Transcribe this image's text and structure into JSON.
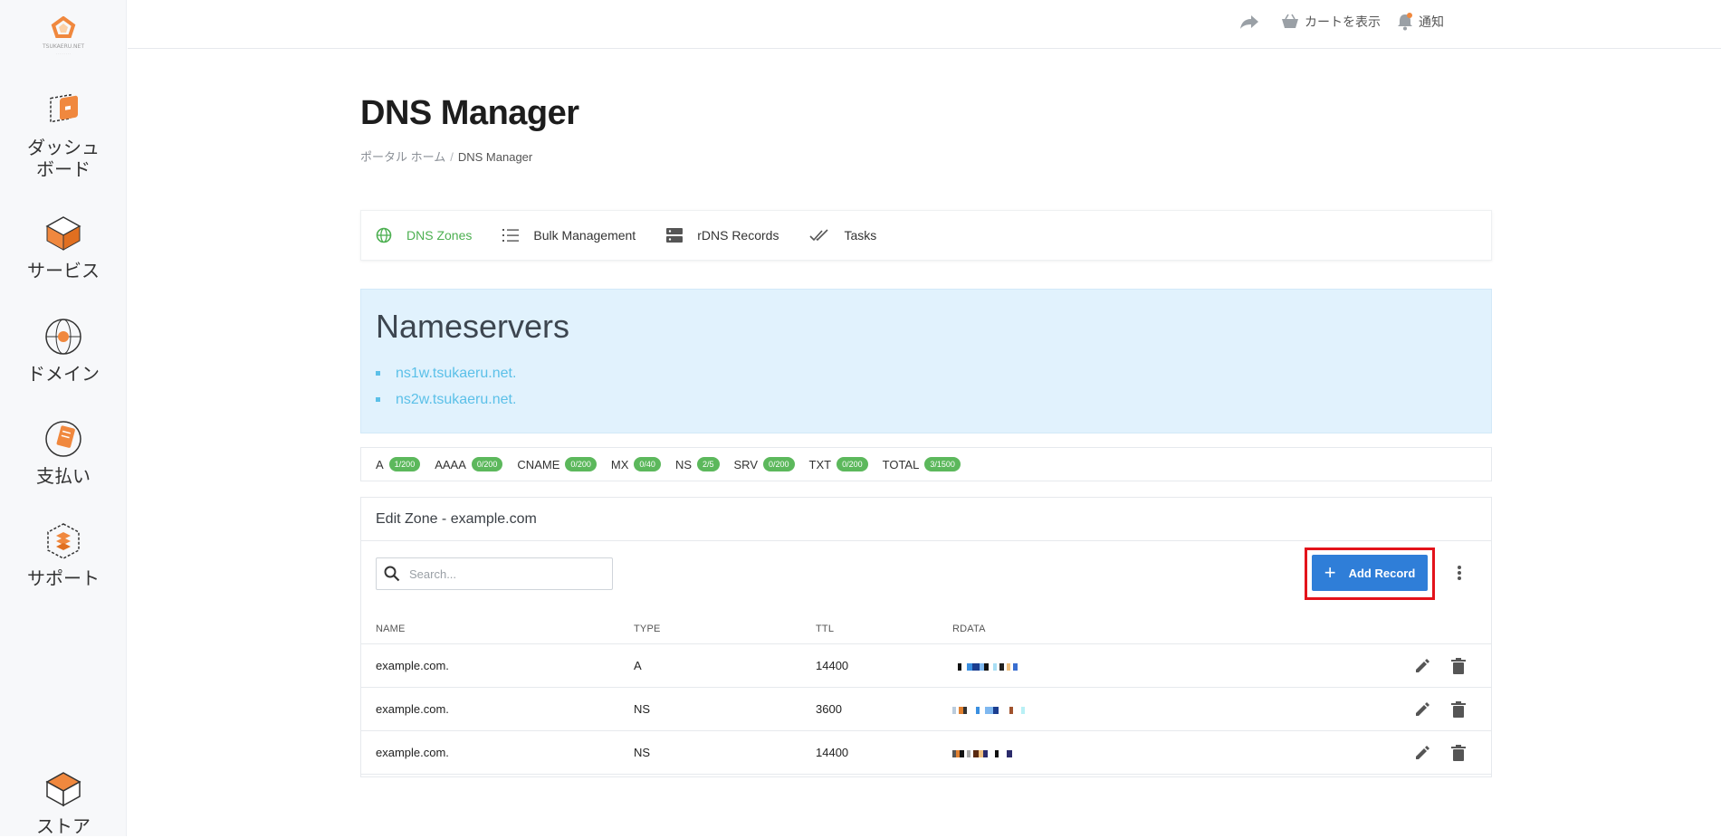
{
  "sidebar": {
    "logo_text": "TSUKAERU.NET",
    "items": [
      {
        "label_line1": "ダッシュ",
        "label_line2": "ボード",
        "icon": "dashboard-icon"
      },
      {
        "label_line1": "サービス",
        "label_line2": "",
        "icon": "services-box-icon"
      },
      {
        "label_line1": "ドメイン",
        "label_line2": "",
        "icon": "globe-icon"
      },
      {
        "label_line1": "支払い",
        "label_line2": "",
        "icon": "billing-icon"
      },
      {
        "label_line1": "サポート",
        "label_line2": "",
        "icon": "support-icon"
      },
      {
        "label_line1": "ストア",
        "label_line2": "",
        "icon": "store-icon"
      }
    ]
  },
  "topbar": {
    "cart_label": "カートを表示",
    "notify_label": "通知"
  },
  "page": {
    "title": "DNS Manager",
    "breadcrumb": [
      "ポータル ホーム",
      "DNS Manager"
    ]
  },
  "tabs": [
    {
      "label": "DNS Zones",
      "active": true
    },
    {
      "label": "Bulk Management",
      "active": false
    },
    {
      "label": "rDNS Records",
      "active": false
    },
    {
      "label": "Tasks",
      "active": false
    }
  ],
  "nameservers": {
    "title": "Nameservers",
    "items": [
      "ns1w.tsukaeru.net.",
      "ns2w.tsukaeru.net."
    ]
  },
  "record_counts": [
    {
      "type": "A",
      "count": "1/200"
    },
    {
      "type": "AAAA",
      "count": "0/200"
    },
    {
      "type": "CNAME",
      "count": "0/200"
    },
    {
      "type": "MX",
      "count": "0/40"
    },
    {
      "type": "NS",
      "count": "2/5"
    },
    {
      "type": "SRV",
      "count": "0/200"
    },
    {
      "type": "TXT",
      "count": "0/200"
    },
    {
      "type": "TOTAL",
      "count": "3/1500"
    }
  ],
  "zone": {
    "title": "Edit Zone - example.com",
    "search_placeholder": "Search...",
    "add_record_label": "Add Record",
    "columns": [
      "NAME",
      "TYPE",
      "TTL",
      "RDATA"
    ],
    "rows": [
      {
        "name": "example.com.",
        "type": "A",
        "ttl": "14400"
      },
      {
        "name": "example.com.",
        "type": "NS",
        "ttl": "3600"
      },
      {
        "name": "example.com.",
        "type": "NS",
        "ttl": "14400"
      }
    ]
  },
  "colors": {
    "accent_green": "#4caf50",
    "badge_green": "#5cb85c",
    "primary_blue": "#2f7ed8",
    "ns_box_bg": "#e1f2fd",
    "highlight_red": "#e3131b",
    "brand_orange": "#f0883e"
  }
}
